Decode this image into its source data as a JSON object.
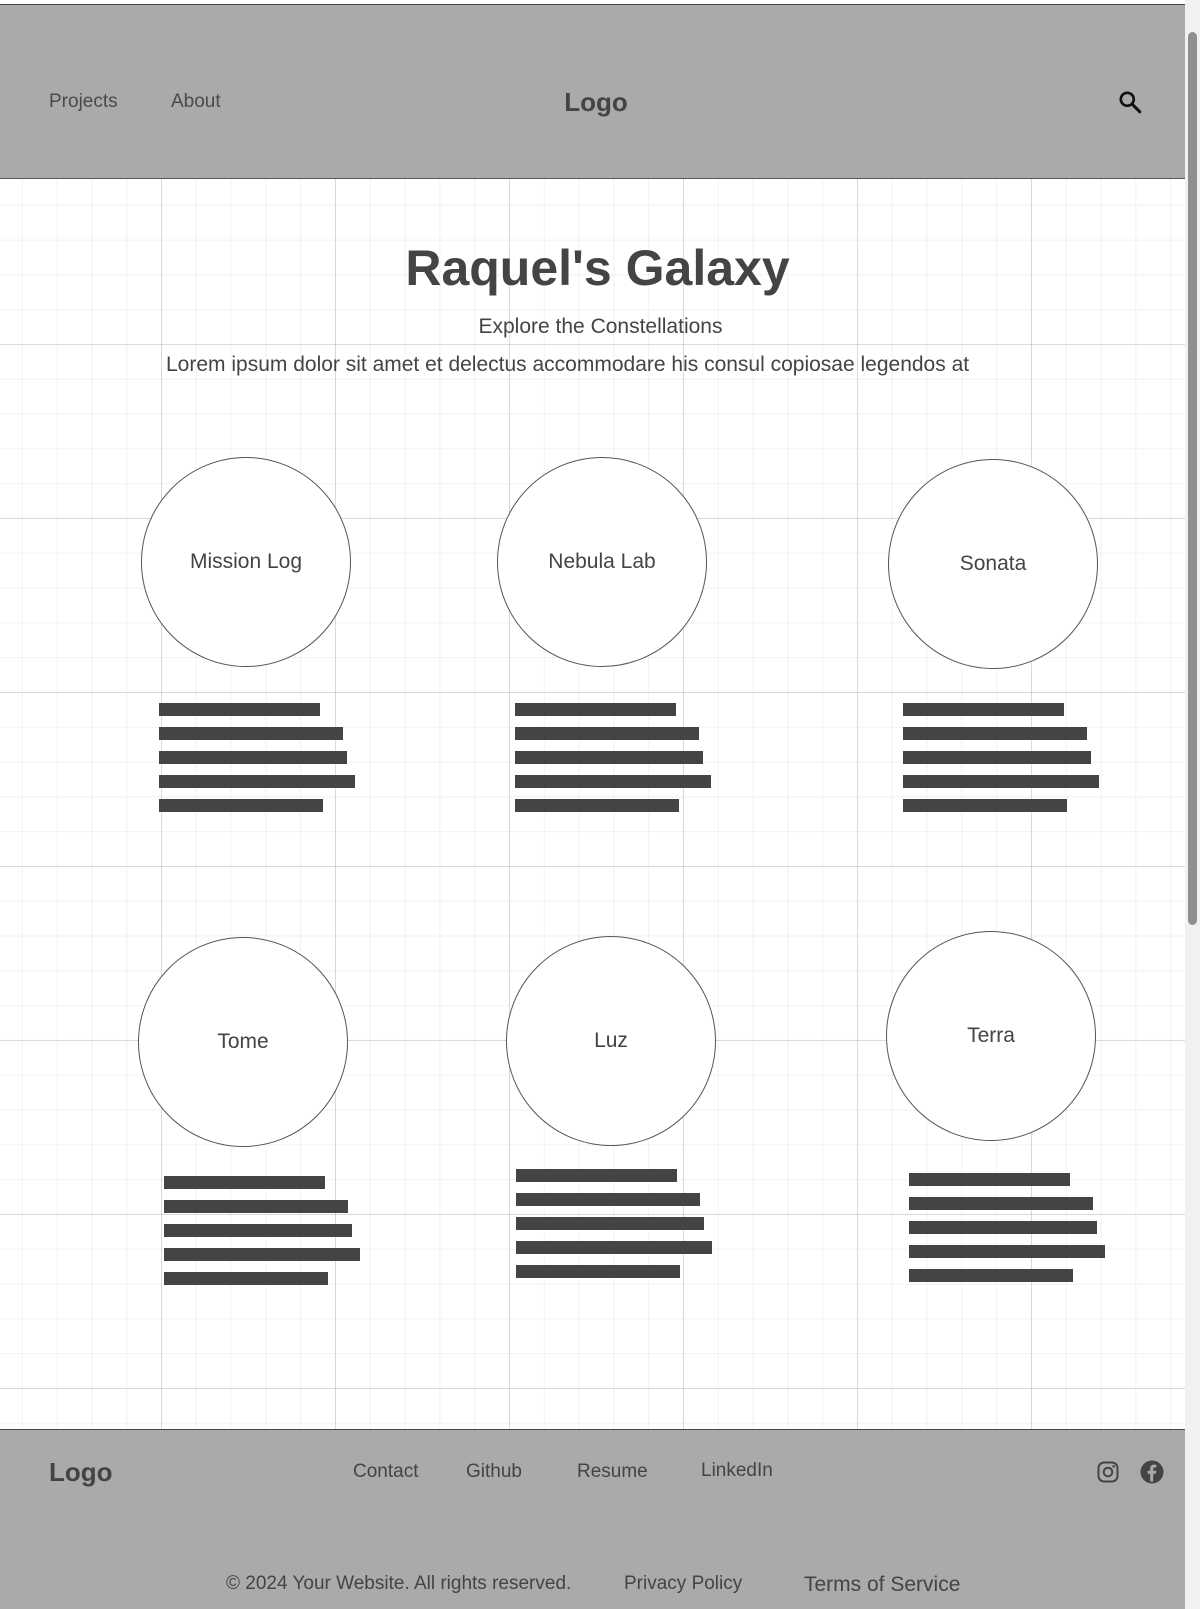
{
  "header": {
    "nav": [
      "Projects",
      "About"
    ],
    "logo": "Logo",
    "search_icon": "search-icon"
  },
  "hero": {
    "title": "Raquel's Galaxy",
    "subtitle": "Explore the Constellations",
    "description": "Lorem ipsum dolor sit amet et delectus accommodare his consul copiosae legendos at"
  },
  "projects": [
    {
      "name": "Mission Log"
    },
    {
      "name": "Nebula Lab"
    },
    {
      "name": "Sonata"
    },
    {
      "name": "Tome"
    },
    {
      "name": "Luz"
    },
    {
      "name": "Terra"
    }
  ],
  "footer": {
    "logo": "Logo",
    "links": [
      "Contact",
      "Github",
      "Resume",
      "LinkedIn"
    ],
    "social_icons": [
      "instagram-icon",
      "facebook-icon"
    ],
    "copyright": "© 2024 Your Website. All rights reserved.",
    "privacy": "Privacy Policy",
    "terms": "Terms of Service"
  },
  "colors": {
    "header_bg": "#aaaaaa",
    "text": "#444444",
    "placeholder_bar": "#444444"
  }
}
